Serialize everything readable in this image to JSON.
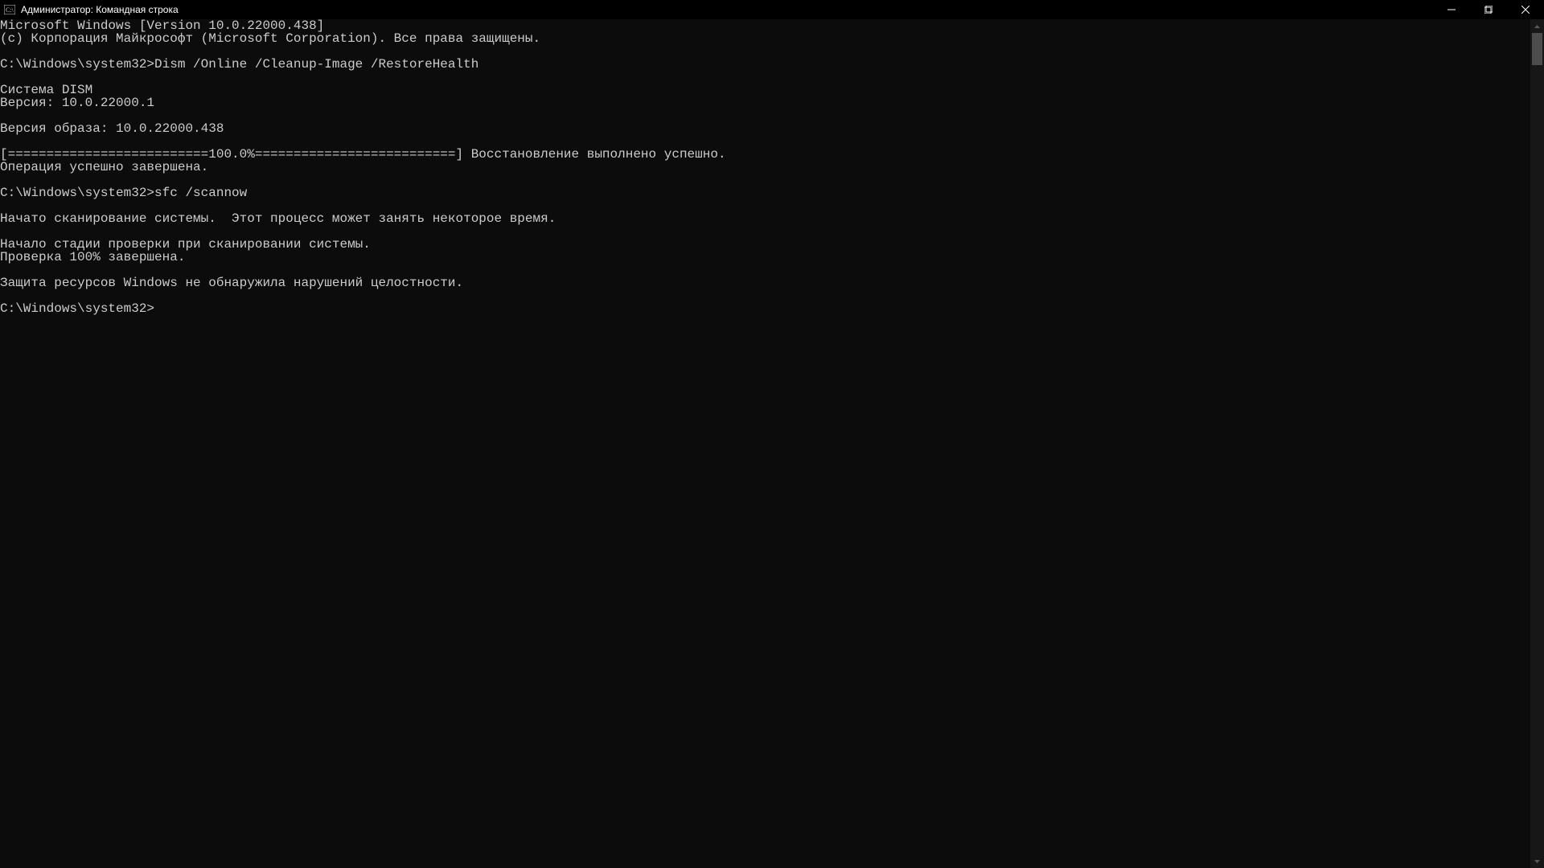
{
  "window": {
    "title": "Администратор: Командная строка"
  },
  "terminal": {
    "lines": [
      "Microsoft Windows [Version 10.0.22000.438]",
      "(c) Корпорация Майкрософт (Microsoft Corporation). Все права защищены.",
      "",
      "C:\\Windows\\system32>Dism /Online /Cleanup-Image /RestoreHealth",
      "",
      "Cистема DISM",
      "Версия: 10.0.22000.1",
      "",
      "Версия образа: 10.0.22000.438",
      "",
      "[==========================100.0%==========================] Восстановление выполнено успешно.",
      "Операция успешно завершена.",
      "",
      "C:\\Windows\\system32>sfc /scannow",
      "",
      "Начато сканирование системы.  Этот процесс может занять некоторое время.",
      "",
      "Начало стадии проверки при сканировании системы.",
      "Проверка 100% завершена.",
      "",
      "Защита ресурсов Windows не обнаружила нарушений целостности.",
      "",
      "C:\\Windows\\system32>"
    ]
  }
}
